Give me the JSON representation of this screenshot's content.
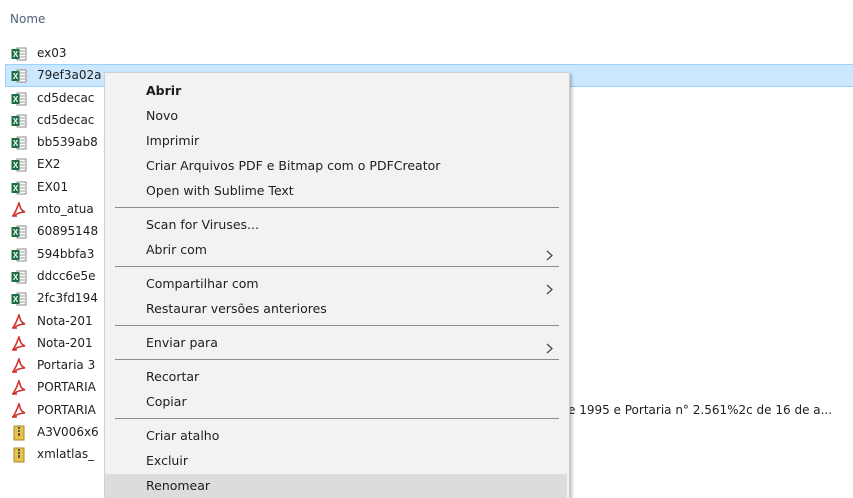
{
  "list": {
    "column_header": "Nome",
    "files": [
      {
        "name": "ex03",
        "icon": "excel-file-icon",
        "selected": false
      },
      {
        "name": "79ef3a02a",
        "icon": "excel-file-icon",
        "selected": true
      },
      {
        "name": "cd5decac",
        "icon": "excel-file-icon",
        "selected": false
      },
      {
        "name": "cd5decac",
        "icon": "excel-file-icon",
        "selected": false
      },
      {
        "name": "bb539ab8",
        "icon": "excel-file-icon",
        "selected": false
      },
      {
        "name": "EX2",
        "icon": "excel-file-icon",
        "selected": false
      },
      {
        "name": "EX01",
        "icon": "excel-file-icon",
        "selected": false
      },
      {
        "name": "mto_atua",
        "icon": "pdf-file-icon",
        "selected": false
      },
      {
        "name": "60895148",
        "icon": "excel-file-icon",
        "selected": false
      },
      {
        "name": "594bbfa3",
        "icon": "excel-file-icon",
        "selected": false
      },
      {
        "name": "ddcc6e5e",
        "icon": "excel-file-icon",
        "selected": false
      },
      {
        "name": "2fc3fd194",
        "icon": "excel-file-icon",
        "selected": false
      },
      {
        "name": "Nota-201",
        "icon": "pdf-file-icon",
        "selected": false
      },
      {
        "name": "Nota-201",
        "icon": "pdf-file-icon",
        "selected": false
      },
      {
        "name": "Portaria 3",
        "icon": "pdf-file-icon",
        "selected": false
      },
      {
        "name": "PORTARIA",
        "icon": "pdf-file-icon",
        "selected": false
      },
      {
        "name": "PORTARIA",
        "icon": "pdf-file-icon",
        "selected": false,
        "extra": "e 1995 e Portaria n° 2.561%2c de 16 de a..."
      },
      {
        "name": "A3V006x6",
        "icon": "archive-file-icon",
        "selected": false
      },
      {
        "name": "xmlatlas_",
        "icon": "archive-file-icon",
        "selected": false
      }
    ]
  },
  "context_menu": {
    "items": [
      {
        "label": "Abrir",
        "bold": true,
        "arrow": false
      },
      {
        "label": "Novo",
        "bold": false,
        "arrow": false
      },
      {
        "label": "Imprimir",
        "bold": false,
        "arrow": false
      },
      {
        "label": "Criar Arquivos PDF e Bitmap com o PDFCreator",
        "bold": false,
        "arrow": false
      },
      {
        "label": "Open with Sublime Text",
        "bold": false,
        "arrow": false
      },
      {
        "separator": true
      },
      {
        "label": "Scan for Viruses...",
        "bold": false,
        "arrow": false
      },
      {
        "label": "Abrir com",
        "bold": false,
        "arrow": true
      },
      {
        "separator": true
      },
      {
        "label": "Compartilhar com",
        "bold": false,
        "arrow": true
      },
      {
        "label": "Restaurar versões anteriores",
        "bold": false,
        "arrow": false
      },
      {
        "separator": true
      },
      {
        "label": "Enviar para",
        "bold": false,
        "arrow": true
      },
      {
        "separator": true
      },
      {
        "label": "Recortar",
        "bold": false,
        "arrow": false
      },
      {
        "label": "Copiar",
        "bold": false,
        "arrow": false
      },
      {
        "separator": true
      },
      {
        "label": "Criar atalho",
        "bold": false,
        "arrow": false
      },
      {
        "label": "Excluir",
        "bold": false,
        "arrow": false
      },
      {
        "label": "Renomear",
        "bold": false,
        "arrow": false,
        "hover": true
      }
    ]
  },
  "colors": {
    "selection_bg": "#cce8ff",
    "menu_bg": "#f2f2f2",
    "hover_bg": "#dcdcdc",
    "excel_green": "#1d7044",
    "pdf_red": "#d0342c",
    "archive_yellow": "#e8c44a"
  }
}
